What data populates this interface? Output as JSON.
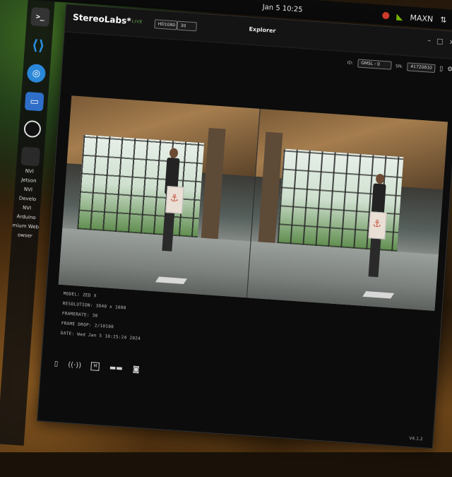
{
  "topbar": {
    "clock": "Jan 5 10:25",
    "tray_brand": "MAXN"
  },
  "dock": {
    "items": [
      {
        "name": "terminal",
        "glyph": ">_"
      },
      {
        "name": "vscode",
        "glyph": "⟨⟩"
      },
      {
        "name": "chromium",
        "glyph": "◎"
      },
      {
        "name": "code-editor",
        "glyph": "▭"
      },
      {
        "name": "obs",
        "glyph": "◉"
      }
    ],
    "desktop_labels": [
      "NVI",
      "Jetson",
      "NVI",
      "Develo",
      "NVI",
      "Arduino",
      "mium Web",
      "owser"
    ]
  },
  "window": {
    "logo": "StereoLabs*",
    "live_label": "LIVE",
    "resolution_select": "HD1080",
    "fps_select": "30",
    "title": "Explorer",
    "id_label": "ID:",
    "id_value": "GMSL - 0",
    "sn_label": "SN:",
    "sn_value": "41720810"
  },
  "info": {
    "model": "MODEL: ZED X",
    "resolution": "RESOLUTION: 3840 x 1080",
    "framerate": "FRAMERATE: 30",
    "frame_drop": "FRAME DROP: 2/10100",
    "date": "DATE: Wed Jan 5 10:25:24 2024"
  },
  "bottom_icons": [
    "folder-icon",
    "broadcast-icon",
    "record-m-icon",
    "link-icon",
    "snapshot-icon"
  ],
  "version": "V4.1.2"
}
